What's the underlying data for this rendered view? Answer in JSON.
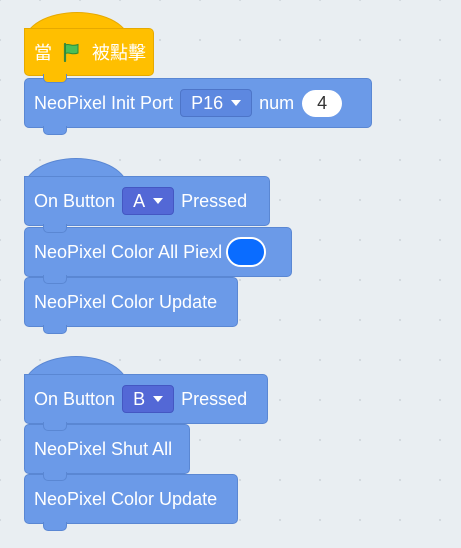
{
  "script1": {
    "event": {
      "prefix": "當",
      "suffix": "被點擊",
      "icon": "green-flag-icon",
      "color": "#ffbf00"
    },
    "init": {
      "label": "NeoPixel Init Port",
      "port_value": "P16",
      "num_label": "num",
      "num_value": "4"
    }
  },
  "script2": {
    "hat": {
      "prefix": "On Button",
      "button_value": "A",
      "suffix": "Pressed"
    },
    "color_all": {
      "label": "NeoPixel Color All Piexl",
      "color": "#0a6cff"
    },
    "update": {
      "label": "NeoPixel Color Update"
    }
  },
  "script3": {
    "hat": {
      "prefix": "On Button",
      "button_value": "B",
      "suffix": "Pressed"
    },
    "shut": {
      "label": "NeoPixel Shut All"
    },
    "update": {
      "label": "NeoPixel Color Update"
    }
  },
  "theme": {
    "block_color": "#6b9ae8",
    "dropdown_color": "#5368d6",
    "canvas_color": "#e9eef2"
  }
}
